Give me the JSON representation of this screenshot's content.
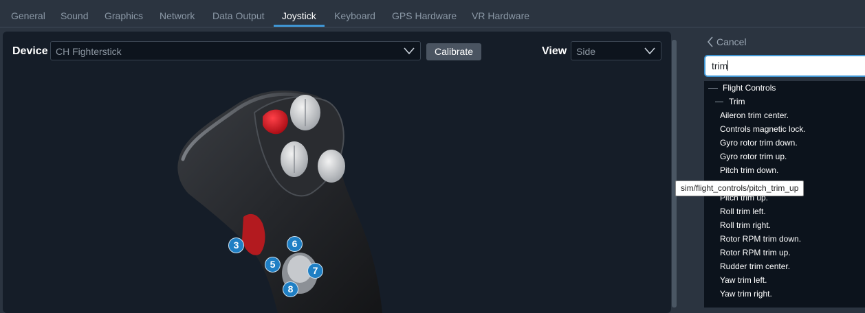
{
  "tabs": [
    {
      "label": "General"
    },
    {
      "label": "Sound"
    },
    {
      "label": "Graphics"
    },
    {
      "label": "Network"
    },
    {
      "label": "Data Output"
    },
    {
      "label": "Joystick",
      "active": true
    },
    {
      "label": "Keyboard"
    },
    {
      "label": "GPS Hardware"
    },
    {
      "label": "VR Hardware"
    }
  ],
  "device": {
    "label": "Device",
    "selected": "CH Fighterstick",
    "calibrate_label": "Calibrate",
    "view_label": "View",
    "view_selected": "Side"
  },
  "badges": [
    "3",
    "6",
    "5",
    "7",
    "8"
  ],
  "search": {
    "cancel_label": "Cancel",
    "query": "trim"
  },
  "results": {
    "group": "Flight Controls",
    "subgroup": "Trim",
    "items": [
      "Aileron trim center.",
      "Controls magnetic lock.",
      "Gyro rotor trim down.",
      "Gyro rotor trim up.",
      "Pitch trim down.",
      "Pitch trim up.",
      "Roll trim left.",
      "Roll trim right.",
      "Rotor RPM trim down.",
      "Rotor RPM trim up.",
      "Rudder trim center.",
      "Yaw trim left.",
      "Yaw trim right."
    ]
  },
  "tooltip": "sim/flight_controls/pitch_trim_up",
  "colors": {
    "accent": "#3f96d4",
    "badge": "#1f7fc4",
    "panel": "#151d28",
    "red_button": "#d8151e"
  }
}
